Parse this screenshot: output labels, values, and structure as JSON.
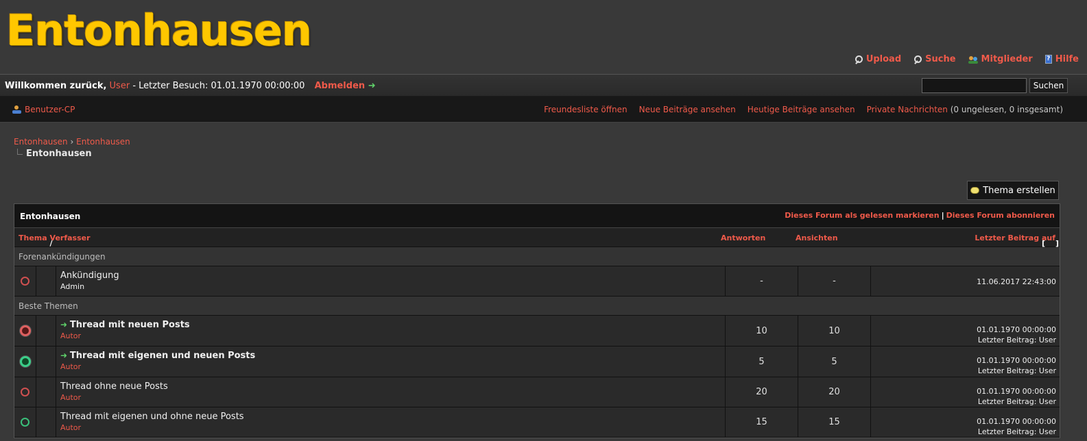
{
  "site": {
    "title": "Entonhausen"
  },
  "toplinks": [
    {
      "label": "Upload",
      "icon": "magnifier-icon"
    },
    {
      "label": "Suche",
      "icon": "magnifier-icon"
    },
    {
      "label": "Mitglieder",
      "icon": "members-icon"
    },
    {
      "label": "Hilfe",
      "icon": "help-icon"
    }
  ],
  "welcome": {
    "prefix": "Willkommen zurück,",
    "user": "User",
    "last_visit": "- Letzter Besuch: 01.01.1970 00:00:00",
    "logout": "Abmelden"
  },
  "search": {
    "button": "Suchen",
    "value": ""
  },
  "navbar": {
    "ucp": "Benutzer-CP",
    "friends": "Freundesliste öffnen",
    "new_posts": "Neue Beiträge ansehen",
    "today_posts": "Heutige Beiträge ansehen",
    "pm": "Private Nachrichten",
    "pm_status": "(0 ungelesen, 0 insgesamt)"
  },
  "breadcrumb": {
    "items": [
      "Entonhausen",
      "Entonhausen"
    ],
    "separator": "›",
    "current": "Entonhausen"
  },
  "new_thread": "Thema erstellen",
  "forum": {
    "title": "Entonhausen",
    "mark_read": "Dieses Forum als gelesen markieren",
    "opts_sep": "|",
    "subscribe": "Dieses Forum abonnieren",
    "columns": {
      "thema": "Thema",
      "slash": "/",
      "verfasser": "Verfasser",
      "antworten": "Antworten",
      "ansichten": "Ansichten",
      "letzter": "Letzter Beitrag",
      "sort_open": "[",
      "sort": "auf",
      "sort_close": "]"
    },
    "sections": [
      {
        "name": "Forenankündigungen",
        "rows": [
          {
            "title": "Ankündigung",
            "author": "Admin",
            "replies": "-",
            "views": "-",
            "date": "11.06.2017 22:43:00",
            "last": ""
          }
        ]
      },
      {
        "name": "Beste Themen",
        "rows": [
          {
            "title": "Thread mit neuen Posts",
            "author": "Autor",
            "replies": "10",
            "views": "10",
            "date": "01.01.1970 00:00:00",
            "last": "Letzter Beitrag: User"
          },
          {
            "title": "Thread mit eigenen und neuen Posts",
            "author": "Autor",
            "replies": "5",
            "views": "5",
            "date": "01.01.1970 00:00:00",
            "last": "Letzter Beitrag: User"
          },
          {
            "title": "Thread ohne neue Posts",
            "author": "Autor",
            "replies": "20",
            "views": "20",
            "date": "01.01.1970 00:00:00",
            "last": "Letzter Beitrag: User"
          },
          {
            "title": "Thread mit eigenen und ohne neue Posts",
            "author": "Autor",
            "replies": "15",
            "views": "15",
            "date": "01.01.1970 00:00:00",
            "last": "Letzter Beitrag: User"
          }
        ]
      }
    ]
  },
  "colors": {
    "accent": "#f05a4a",
    "logo": "#ffc700",
    "new_arrow": "#5fd06a"
  }
}
